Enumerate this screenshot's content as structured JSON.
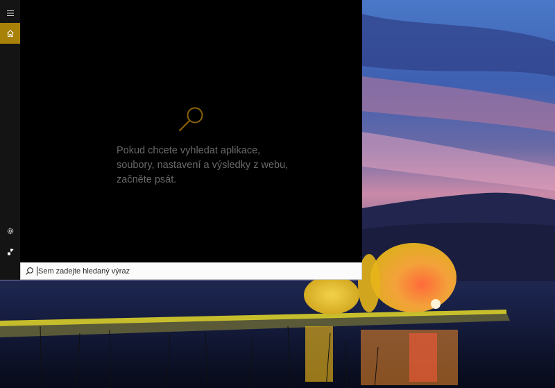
{
  "search": {
    "placeholder": "Sem zadejte hledaný výraz",
    "value": ""
  },
  "empty_state": {
    "message": "Pokud chcete vyhledat aplikace, soubory, nastavení a výsledky z webu, začněte psát."
  },
  "rail": {
    "items": [
      {
        "icon": "hamburger-menu-icon",
        "selected": false
      },
      {
        "icon": "home-icon",
        "selected": true
      },
      {
        "icon": "gear-icon",
        "selected": false
      },
      {
        "icon": "account-icon",
        "selected": false
      }
    ]
  },
  "colors": {
    "accent": "#a88208",
    "rail_bg": "#151414",
    "panel_bg": "#000000",
    "hint_text": "#696969",
    "search_icon": "#9a6e0a"
  }
}
